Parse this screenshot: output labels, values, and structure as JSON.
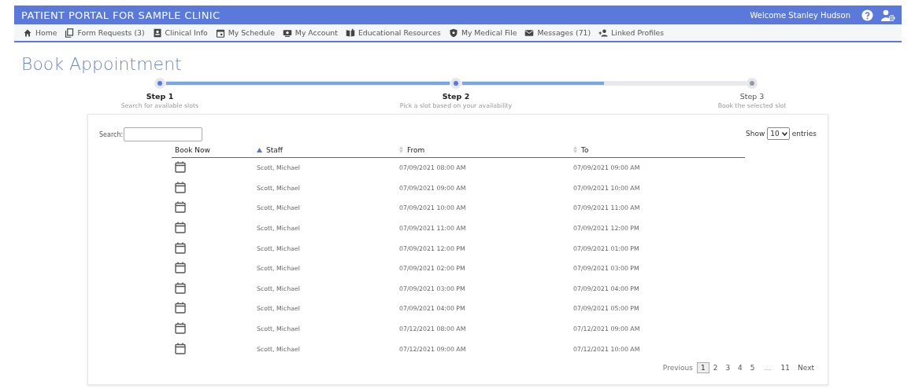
{
  "header": {
    "title": "PATIENT PORTAL FOR SAMPLE CLINIC",
    "welcome": "Welcome Stanley Hudson"
  },
  "nav": [
    {
      "label": "Home"
    },
    {
      "label": "Form Requests (3)"
    },
    {
      "label": "Clinical Info"
    },
    {
      "label": "My Schedule"
    },
    {
      "label": "My Account"
    },
    {
      "label": "Educational Resources"
    },
    {
      "label": "My Medical File"
    },
    {
      "label": "Messages (71)"
    },
    {
      "label": "Linked Profiles"
    }
  ],
  "page_title": "Book Appointment",
  "stepper": {
    "connectors": [
      {
        "level": 1
      },
      {
        "level": 0.5
      }
    ],
    "steps": [
      {
        "title": "Step 1",
        "subtitle": "Search for available slots",
        "reached": true
      },
      {
        "title": "Step 2",
        "subtitle": "Pick a slot based on your availability",
        "reached": true
      },
      {
        "title": "Step 3",
        "subtitle": "Book the selected slot",
        "reached": false
      }
    ]
  },
  "table": {
    "search_label": "Search:",
    "show_label": "Show",
    "page_size": "10",
    "entries_label": "entries",
    "columns": [
      {
        "label": "Book Now",
        "sortable": false
      },
      {
        "label": "Staff",
        "sortable": true,
        "sorted": true
      },
      {
        "label": "From",
        "sortable": true,
        "sorted": false
      },
      {
        "label": "To",
        "sortable": true,
        "sorted": false
      }
    ],
    "rows": [
      {
        "staff": "Scott, Michael",
        "from": "07/09/2021 08:00 AM",
        "to": "07/09/2021 09:00 AM"
      },
      {
        "staff": "Scott, Michael",
        "from": "07/09/2021 09:00 AM",
        "to": "07/09/2021 10:00 AM"
      },
      {
        "staff": "Scott, Michael",
        "from": "07/09/2021 10:00 AM",
        "to": "07/09/2021 11:00 AM"
      },
      {
        "staff": "Scott, Michael",
        "from": "07/09/2021 11:00 AM",
        "to": "07/09/2021 12:00 PM"
      },
      {
        "staff": "Scott, Michael",
        "from": "07/09/2021 12:00 PM",
        "to": "07/09/2021 01:00 PM"
      },
      {
        "staff": "Scott, Michael",
        "from": "07/09/2021 02:00 PM",
        "to": "07/09/2021 03:00 PM"
      },
      {
        "staff": "Scott, Michael",
        "from": "07/09/2021 03:00 PM",
        "to": "07/09/2021 04:00 PM"
      },
      {
        "staff": "Scott, Michael",
        "from": "07/09/2021 04:00 PM",
        "to": "07/09/2021 05:00 PM"
      },
      {
        "staff": "Scott, Michael",
        "from": "07/12/2021 08:00 AM",
        "to": "07/12/2021 09:00 AM"
      },
      {
        "staff": "Scott, Michael",
        "from": "07/12/2021 09:00 AM",
        "to": "07/12/2021 10:00 AM"
      }
    ]
  },
  "pagination": {
    "previous": {
      "label": "Previous",
      "disabled": true
    },
    "pages": [
      {
        "label": "1",
        "selected": true
      },
      {
        "label": "2",
        "selected": false
      },
      {
        "label": "3",
        "selected": false
      },
      {
        "label": "4",
        "selected": false
      },
      {
        "label": "5",
        "selected": false
      }
    ],
    "ellipsis": "…",
    "last": {
      "label": "11",
      "selected": false
    },
    "next": {
      "label": "Next",
      "disabled": false
    }
  }
}
